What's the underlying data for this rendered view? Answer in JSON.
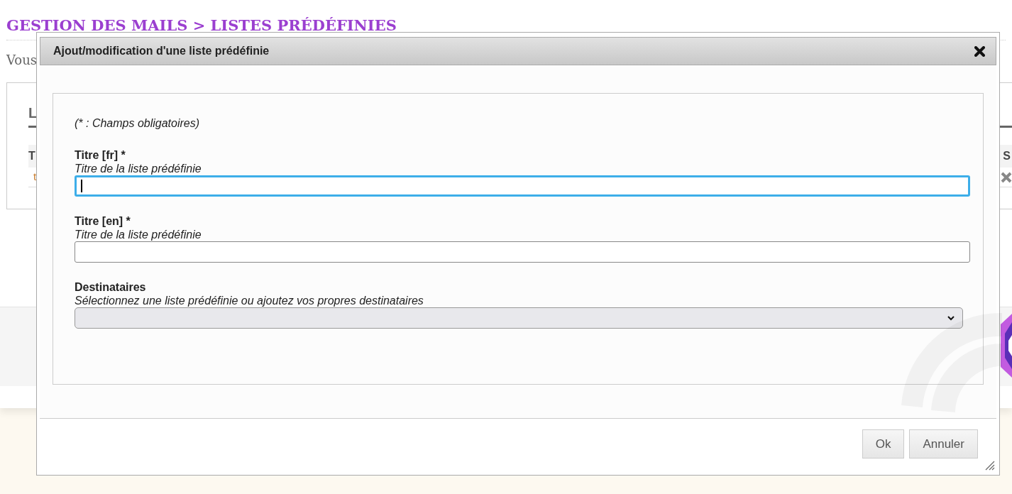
{
  "page": {
    "breadcrumb": "GESTION DES MAILS > LISTES PRÉDÉFINIES",
    "intro": "Vous",
    "card_heading": "L",
    "table": {
      "columns": [
        "T",
        "S"
      ],
      "rows": [
        {
          "cell": "t"
        }
      ]
    }
  },
  "dialog": {
    "title": "Ajout/modification d'une liste prédéfinie",
    "note": "(* : Champs obligatoires)",
    "fields": [
      {
        "kind": "text",
        "label": "Titre [fr] *",
        "help": "Titre de la liste prédéfinie",
        "focused": true
      },
      {
        "kind": "text",
        "label": "Titre [en] *",
        "help": "Titre de la liste prédéfinie",
        "focused": false
      },
      {
        "kind": "select",
        "label": "Destinataires",
        "help": "Sélectionnez une liste prédéfinie ou ajoutez vos propres destinataires"
      }
    ],
    "buttons": [
      "Ok",
      "Annuler"
    ]
  }
}
